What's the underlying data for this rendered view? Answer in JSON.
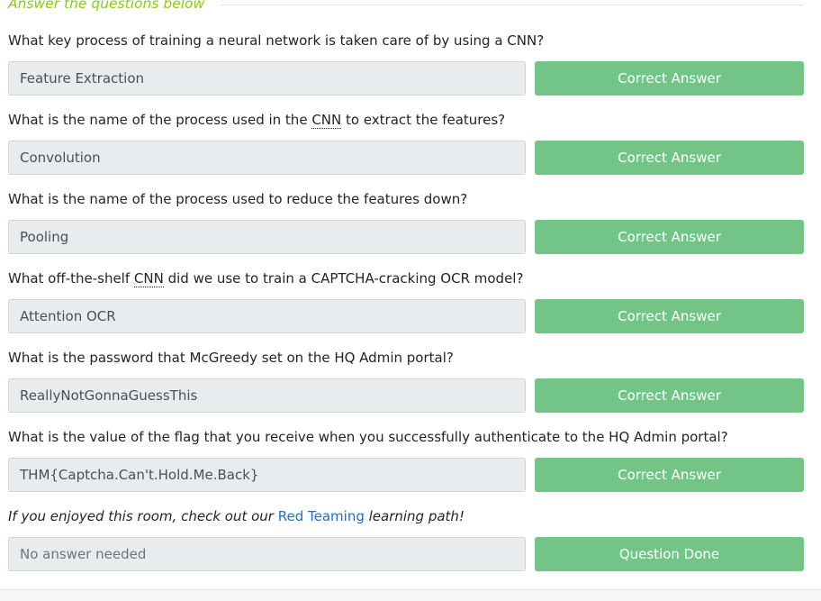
{
  "section": {
    "title": "Answer the questions below"
  },
  "questions": [
    {
      "text": "What key process of training a neural network is taken care of by using a CNN?",
      "answer": "Feature Extraction",
      "button": "Correct Answer"
    },
    {
      "parts": [
        "What is the name of the process used in the ",
        "CNN",
        " to extract the features?"
      ],
      "answer": "Convolution",
      "button": "Correct Answer"
    },
    {
      "text": "What is the name of the process used to reduce the features down?",
      "answer": "Pooling",
      "button": "Correct Answer"
    },
    {
      "parts": [
        "What off-the-shelf ",
        "CNN",
        " did we use to train a CAPTCHA-cracking OCR model?"
      ],
      "answer": "Attention OCR",
      "button": "Correct Answer"
    },
    {
      "text": "What is the password that McGreedy set on the HQ Admin portal?",
      "answer": "ReallyNotGonnaGuessThis",
      "button": "Correct Answer"
    },
    {
      "text": "What is the value of the flag that you receive when you successfully authenticate to the HQ Admin portal?",
      "answer": "THM{Captcha.Can't.Hold.Me.Back}",
      "button": "Correct Answer"
    },
    {
      "parts": [
        "If you enjoyed this room, check out our ",
        "Red Teaming",
        " learning path!"
      ],
      "placeholder": "No answer needed",
      "button": "Question Done"
    }
  ],
  "colors": {
    "accent": "#88cc14",
    "button": "#72c586",
    "link": "#1e6fcf"
  }
}
